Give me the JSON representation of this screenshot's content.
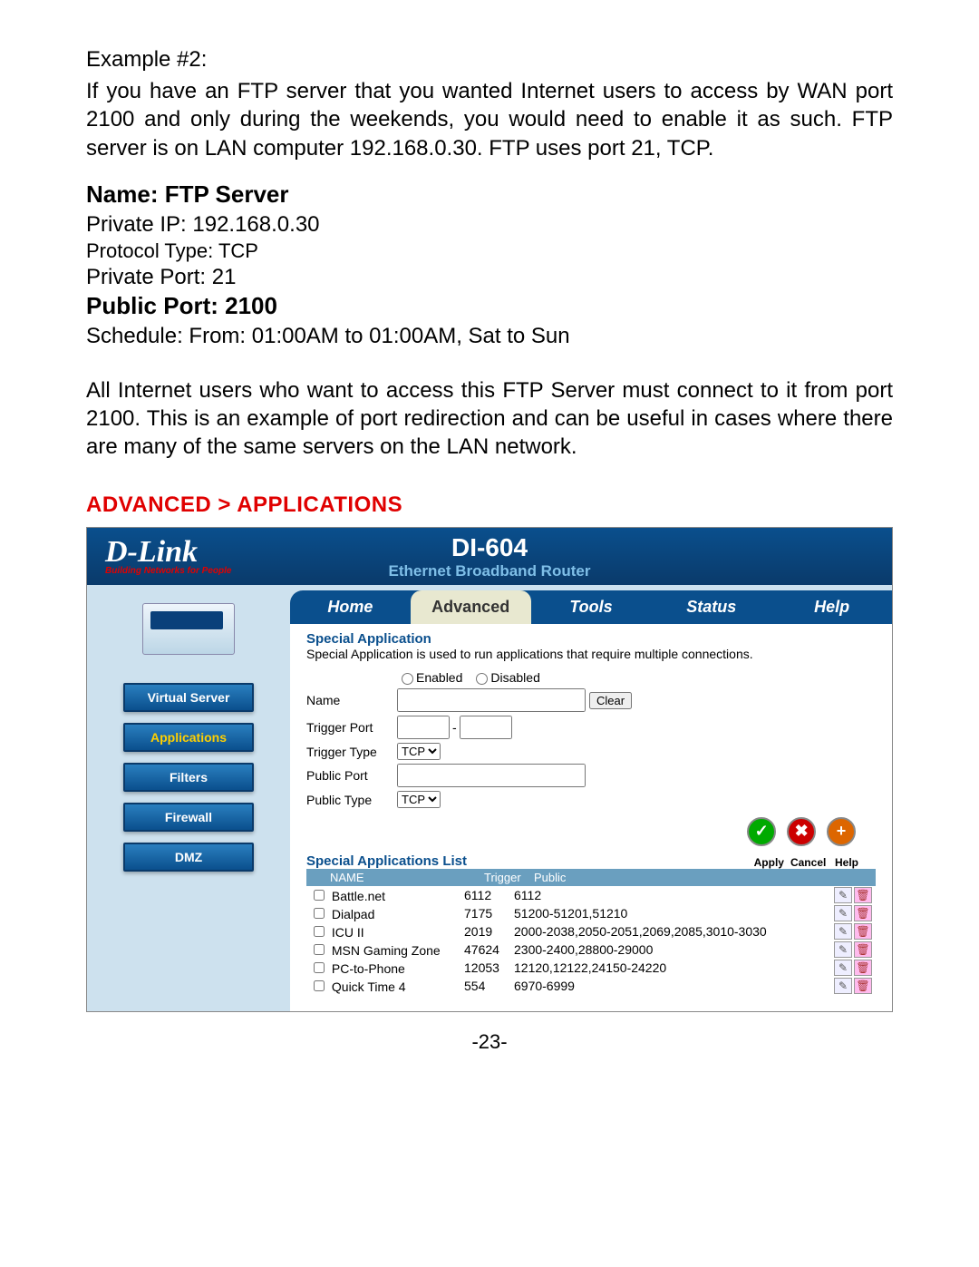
{
  "doc": {
    "example_label": "Example #2:",
    "example_para": "If you have an FTP server that you wanted Internet users to access by WAN port 2100 and only during the weekends, you would need to enable it as such. FTP server is on LAN computer 192.168.0.30. FTP uses port 21, TCP.",
    "name_line": "Name: FTP Server",
    "private_ip": "Private IP: 192.168.0.30",
    "protocol_type": "Protocol Type: TCP",
    "private_port": "Private Port: 21",
    "public_port": "Public Port: 2100",
    "schedule": "Schedule: From: 01:00AM to 01:00AM, Sat to Sun",
    "note_para": "All Internet users who want to access this FTP Server must connect to it from port 2100. This is an example of port redirection and can be useful in cases where there are many of the same servers on the LAN network.",
    "section_header": "ADVANCED > APPLICATIONS",
    "page_number": "-23-"
  },
  "ui": {
    "brand": "D-Link",
    "tagline": "Building Networks for People",
    "model": "DI-604",
    "model_desc": "Ethernet Broadband Router",
    "tabs": [
      "Home",
      "Advanced",
      "Tools",
      "Status",
      "Help"
    ],
    "side_buttons": [
      "Virtual Server",
      "Applications",
      "Filters",
      "Firewall",
      "DMZ"
    ],
    "section_title": "Special Application",
    "section_desc": "Special Application is used to run applications that require multiple connections.",
    "enabled_label": "Enabled",
    "disabled_label": "Disabled",
    "form": {
      "name": "Name",
      "trigger_port": "Trigger Port",
      "trigger_type": "Trigger Type",
      "public_port": "Public Port",
      "public_type": "Public Type",
      "type_value": "TCP",
      "clear": "Clear",
      "dash": "-"
    },
    "actions": {
      "apply": "Apply",
      "cancel": "Cancel",
      "help": "Help"
    },
    "list_title": "Special Applications List",
    "list_headers": {
      "name": "NAME",
      "trigger": "Trigger",
      "public": "Public"
    },
    "list": [
      {
        "name": "Battle.net",
        "trigger": "6112",
        "public": "6112"
      },
      {
        "name": "Dialpad",
        "trigger": "7175",
        "public": "51200-51201,51210"
      },
      {
        "name": "ICU II",
        "trigger": "2019",
        "public": "2000-2038,2050-2051,2069,2085,3010-3030"
      },
      {
        "name": "MSN Gaming Zone",
        "trigger": "47624",
        "public": "2300-2400,28800-29000"
      },
      {
        "name": "PC-to-Phone",
        "trigger": "12053",
        "public": "12120,12122,24150-24220"
      },
      {
        "name": "Quick Time 4",
        "trigger": "554",
        "public": "6970-6999"
      }
    ]
  }
}
